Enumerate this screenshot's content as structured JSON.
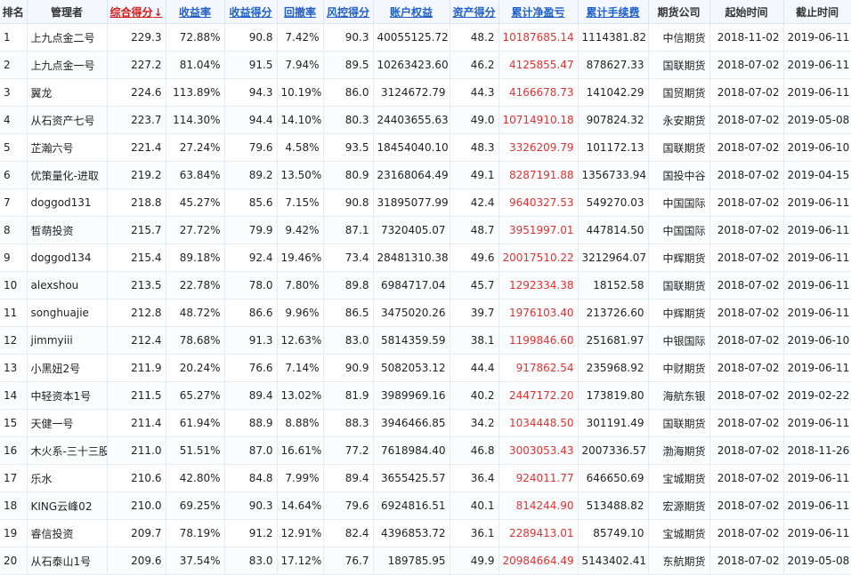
{
  "headers": {
    "rank": "排名",
    "manager": "管理者",
    "composite_score": "综合得分",
    "sort_arrow": "↓",
    "return_rate": "收益率",
    "return_score": "收益得分",
    "drawdown": "回撤率",
    "risk_score": "风控得分",
    "equity": "账户权益",
    "asset_score": "资产得分",
    "cum_pnl": "累计净盈亏",
    "cum_fee": "累计手续费",
    "futures_company": "期货公司",
    "start_date": "起始时间",
    "end_date": "截止时间"
  },
  "rows": [
    {
      "rank": "1",
      "manager": "上九点金二号",
      "score": "229.3",
      "ret": "72.88%",
      "rscore": "90.8",
      "dd": "7.42%",
      "risk": "90.3",
      "equity": "40055125.72",
      "ascore": "48.2",
      "pnl": "10187685.14",
      "fee": "1114381.82",
      "co": "中信期货",
      "start": "2018-11-02",
      "end": "2019-06-11"
    },
    {
      "rank": "2",
      "manager": "上九点金一号",
      "score": "227.2",
      "ret": "81.04%",
      "rscore": "91.5",
      "dd": "7.94%",
      "risk": "89.5",
      "equity": "10263423.60",
      "ascore": "46.2",
      "pnl": "4125855.47",
      "fee": "878627.33",
      "co": "国联期货",
      "start": "2018-07-02",
      "end": "2019-06-11"
    },
    {
      "rank": "3",
      "manager": "翼龙",
      "score": "224.6",
      "ret": "113.89%",
      "rscore": "94.3",
      "dd": "10.19%",
      "risk": "86.0",
      "equity": "3124672.79",
      "ascore": "44.3",
      "pnl": "4166678.73",
      "fee": "141042.29",
      "co": "国贸期货",
      "start": "2018-07-02",
      "end": "2019-06-11"
    },
    {
      "rank": "4",
      "manager": "从石资产七号",
      "score": "223.7",
      "ret": "114.30%",
      "rscore": "94.4",
      "dd": "14.10%",
      "risk": "80.3",
      "equity": "24403655.63",
      "ascore": "49.0",
      "pnl": "10714910.18",
      "fee": "907824.32",
      "co": "永安期货",
      "start": "2018-07-02",
      "end": "2019-05-08"
    },
    {
      "rank": "5",
      "manager": "芷瀚六号",
      "score": "221.4",
      "ret": "27.24%",
      "rscore": "79.6",
      "dd": "4.58%",
      "risk": "93.5",
      "equity": "18454040.10",
      "ascore": "48.3",
      "pnl": "3326209.79",
      "fee": "101172.13",
      "co": "国联期货",
      "start": "2018-07-02",
      "end": "2019-06-10"
    },
    {
      "rank": "6",
      "manager": "优策量化-进取",
      "score": "219.2",
      "ret": "63.84%",
      "rscore": "89.2",
      "dd": "13.50%",
      "risk": "80.9",
      "equity": "23168064.49",
      "ascore": "49.1",
      "pnl": "8287191.88",
      "fee": "1356733.94",
      "co": "国投中谷",
      "start": "2018-07-02",
      "end": "2019-04-15"
    },
    {
      "rank": "7",
      "manager": "doggod131",
      "score": "218.8",
      "ret": "45.27%",
      "rscore": "85.6",
      "dd": "7.15%",
      "risk": "90.8",
      "equity": "31895077.99",
      "ascore": "42.4",
      "pnl": "9640327.53",
      "fee": "549270.03",
      "co": "中国国际",
      "start": "2018-07-02",
      "end": "2019-06-11"
    },
    {
      "rank": "8",
      "manager": "皙萌投资",
      "score": "215.7",
      "ret": "27.72%",
      "rscore": "79.9",
      "dd": "9.42%",
      "risk": "87.1",
      "equity": "7320405.07",
      "ascore": "48.7",
      "pnl": "3951997.01",
      "fee": "447814.50",
      "co": "中国国际",
      "start": "2018-07-02",
      "end": "2019-06-11"
    },
    {
      "rank": "9",
      "manager": "doggod134",
      "score": "215.4",
      "ret": "89.18%",
      "rscore": "92.4",
      "dd": "19.46%",
      "risk": "73.4",
      "equity": "28481310.38",
      "ascore": "49.6",
      "pnl": "20017510.22",
      "fee": "3212964.07",
      "co": "中辉期货",
      "start": "2018-07-02",
      "end": "2019-06-11"
    },
    {
      "rank": "10",
      "manager": "alexshou",
      "score": "213.5",
      "ret": "22.78%",
      "rscore": "78.0",
      "dd": "7.80%",
      "risk": "89.8",
      "equity": "6984717.04",
      "ascore": "45.7",
      "pnl": "1292334.38",
      "fee": "18152.58",
      "co": "国联期货",
      "start": "2018-07-02",
      "end": "2019-06-11"
    },
    {
      "rank": "11",
      "manager": "songhuajie",
      "score": "212.8",
      "ret": "48.72%",
      "rscore": "86.6",
      "dd": "9.96%",
      "risk": "86.5",
      "equity": "3475020.26",
      "ascore": "39.7",
      "pnl": "1976103.40",
      "fee": "213726.60",
      "co": "中辉期货",
      "start": "2018-07-02",
      "end": "2019-06-11"
    },
    {
      "rank": "12",
      "manager": "jimmyiii",
      "score": "212.4",
      "ret": "78.68%",
      "rscore": "91.3",
      "dd": "12.63%",
      "risk": "83.0",
      "equity": "5814359.59",
      "ascore": "38.1",
      "pnl": "1199846.60",
      "fee": "251681.97",
      "co": "中银国际",
      "start": "2018-07-02",
      "end": "2019-06-10"
    },
    {
      "rank": "13",
      "manager": "小黑妞2号",
      "score": "211.9",
      "ret": "20.24%",
      "rscore": "76.6",
      "dd": "7.14%",
      "risk": "90.9",
      "equity": "5082053.12",
      "ascore": "44.4",
      "pnl": "917862.54",
      "fee": "235968.92",
      "co": "中财期货",
      "start": "2018-07-02",
      "end": "2019-06-11"
    },
    {
      "rank": "14",
      "manager": "中轻资本1号",
      "score": "211.5",
      "ret": "65.27%",
      "rscore": "89.4",
      "dd": "13.02%",
      "risk": "81.9",
      "equity": "3989969.16",
      "ascore": "40.2",
      "pnl": "2447172.20",
      "fee": "173819.80",
      "co": "海航东银",
      "start": "2018-07-02",
      "end": "2019-02-22"
    },
    {
      "rank": "15",
      "manager": "天健一号",
      "score": "211.4",
      "ret": "61.94%",
      "rscore": "88.9",
      "dd": "8.88%",
      "risk": "88.3",
      "equity": "3946466.85",
      "ascore": "34.2",
      "pnl": "1034448.50",
      "fee": "301191.49",
      "co": "国联期货",
      "start": "2018-07-02",
      "end": "2019-06-11"
    },
    {
      "rank": "16",
      "manager": "木火系-三十三股",
      "score": "211.0",
      "ret": "51.51%",
      "rscore": "87.0",
      "dd": "16.61%",
      "risk": "77.2",
      "equity": "7618984.40",
      "ascore": "46.8",
      "pnl": "3003053.43",
      "fee": "2007336.57",
      "co": "渤海期货",
      "start": "2018-07-02",
      "end": "2018-11-26"
    },
    {
      "rank": "17",
      "manager": "乐水",
      "score": "210.6",
      "ret": "42.80%",
      "rscore": "84.8",
      "dd": "7.99%",
      "risk": "89.4",
      "equity": "3655425.57",
      "ascore": "36.4",
      "pnl": "924011.77",
      "fee": "646650.69",
      "co": "宝城期货",
      "start": "2018-07-02",
      "end": "2019-06-11"
    },
    {
      "rank": "18",
      "manager": "KING云峰02",
      "score": "210.0",
      "ret": "69.25%",
      "rscore": "90.3",
      "dd": "14.64%",
      "risk": "79.6",
      "equity": "6924816.51",
      "ascore": "40.1",
      "pnl": "814244.90",
      "fee": "513488.82",
      "co": "宏源期货",
      "start": "2018-07-02",
      "end": "2019-06-11"
    },
    {
      "rank": "19",
      "manager": "睿信投资",
      "score": "209.7",
      "ret": "78.19%",
      "rscore": "91.2",
      "dd": "12.91%",
      "risk": "82.4",
      "equity": "4396853.72",
      "ascore": "36.1",
      "pnl": "2289413.01",
      "fee": "85749.10",
      "co": "宝城期货",
      "start": "2018-07-02",
      "end": "2019-06-11"
    },
    {
      "rank": "20",
      "manager": "从石泰山1号",
      "score": "209.6",
      "ret": "37.54%",
      "rscore": "83.0",
      "dd": "17.12%",
      "risk": "76.7",
      "equity": "189785.95",
      "ascore": "49.9",
      "pnl": "20984664.49",
      "fee": "5143402.41",
      "co": "东航期货",
      "start": "2018-07-02",
      "end": "2019-05-08"
    }
  ]
}
